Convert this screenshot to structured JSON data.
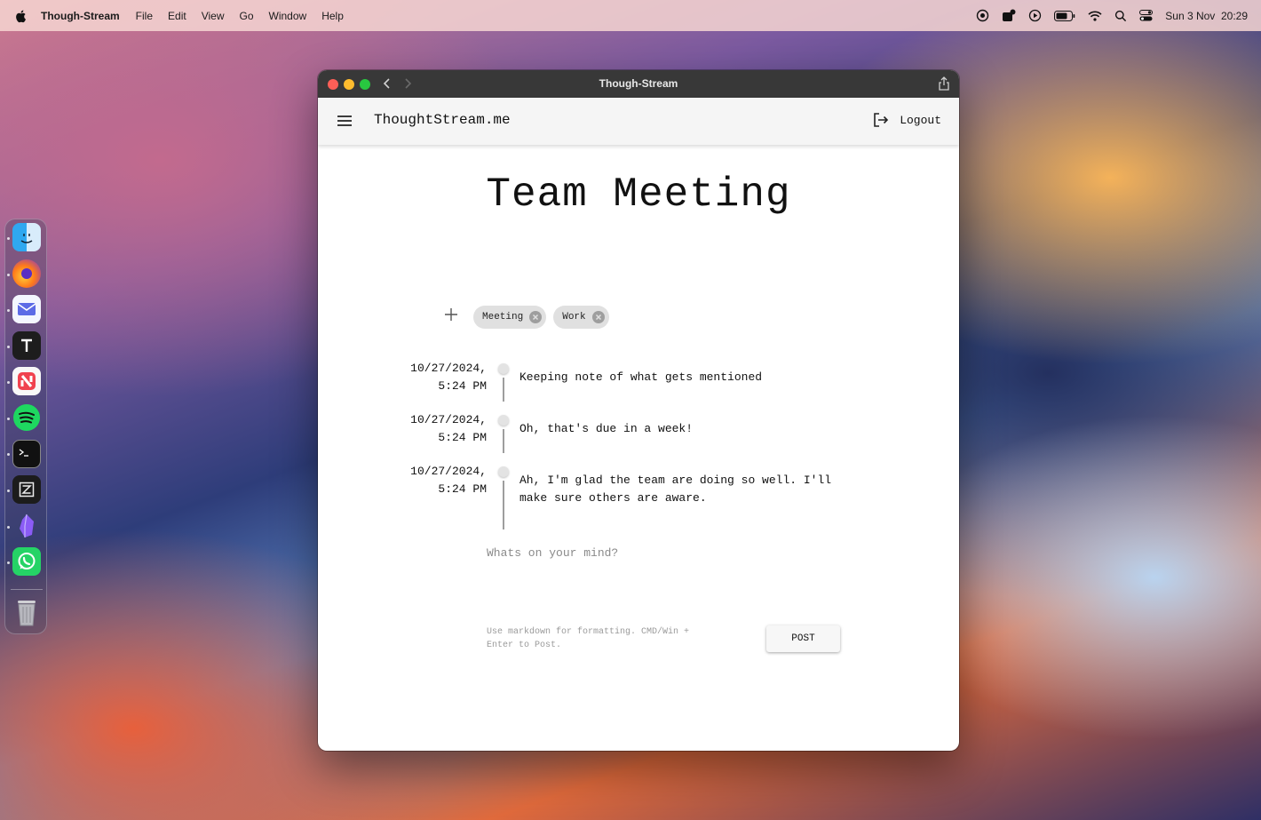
{
  "menubar": {
    "app_name": "Though-Stream",
    "items": [
      "File",
      "Edit",
      "View",
      "Go",
      "Window",
      "Help"
    ],
    "datetime": "Sun 3 Nov  20:29",
    "status_icons": [
      "screen-record-icon",
      "notification-badge-icon",
      "play-icon",
      "battery-icon",
      "wifi-icon",
      "spotlight-search-icon",
      "control-center-icon"
    ]
  },
  "dock": {
    "apps": [
      "finder-icon",
      "firefox-icon",
      "mail-icon",
      "typora-icon",
      "news-icon",
      "spotify-icon",
      "terminal-icon",
      "zed-icon",
      "obsidian-icon",
      "whatsapp-icon",
      "trash-icon"
    ]
  },
  "window": {
    "title": "Though-Stream"
  },
  "appbar": {
    "brand": "ThoughtStream.me",
    "logout_label": "Logout"
  },
  "page": {
    "title": "Team Meeting",
    "tags": [
      "Meeting",
      "Work"
    ],
    "entries": [
      {
        "timestamp": "10/27/2024,\n5:24 PM",
        "text": "Keeping note of what gets mentioned"
      },
      {
        "timestamp": "10/27/2024,\n5:24 PM",
        "text": "Oh, that's due in a week!"
      },
      {
        "timestamp": "10/27/2024,\n5:24 PM",
        "text": "Ah, I'm glad the team are doing so well. I'll make sure others are aware."
      }
    ],
    "compose_placeholder": "Whats on your mind?",
    "hint": "Use markdown for formatting. CMD/Win + Enter to Post.",
    "post_label": "POST"
  },
  "colors": {
    "titlebar": "#383838",
    "appbar": "#f5f5f5",
    "chip": "#e0e0e0",
    "timeline_line": "#9e9e9e"
  }
}
